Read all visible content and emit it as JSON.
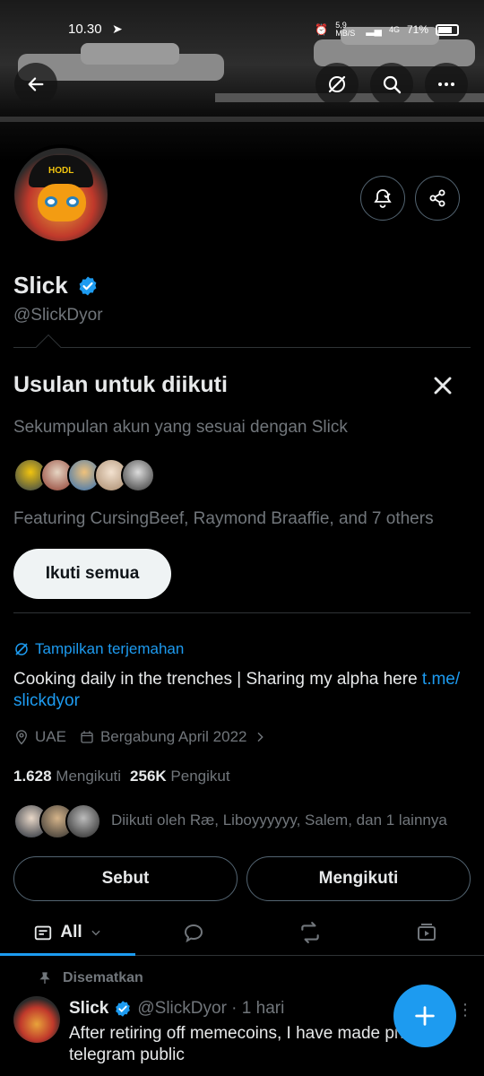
{
  "status_bar": {
    "time": "10.30",
    "network_speed": "5,9 MB/S",
    "network_type": "4G",
    "battery": "71%"
  },
  "header_icons": {
    "back": "arrow-left-icon",
    "grok": "grok-icon",
    "search": "search-icon",
    "more": "more-icon",
    "notify": "bell-check-icon",
    "share": "share-icon"
  },
  "profile": {
    "name": "Slick",
    "handle": "@SlickDyor",
    "avatar_text": "HODL"
  },
  "suggestions": {
    "title": "Usulan untuk diikuti",
    "description": "Sekumpulan akun yang sesuai dengan Slick",
    "featuring": "Featuring CursingBeef, Raymond Braaffie, and 7 others",
    "follow_all_label": "Ikuti semua"
  },
  "bio": {
    "translate_label": "Tampilkan terjemahan",
    "text": "Cooking daily in the trenches | Sharing my alpha here ",
    "link_part1": "t.me/",
    "link_part2": "slickdyor"
  },
  "meta": {
    "location": "UAE",
    "joined": "Bergabung April 2022"
  },
  "stats": {
    "following_count": "1.628",
    "following_label": "Mengikuti",
    "followers_count": "256K",
    "followers_label": "Pengikut"
  },
  "followed_by": "Diikuti oleh Ræ, Liboyyyyyy, Salem, dan 1 lainnya",
  "actions": {
    "mention_label": "Sebut",
    "following_label": "Mengikuti"
  },
  "tabs": {
    "all_label": "All"
  },
  "pinned": {
    "label": "Disematkan",
    "author": "Slick",
    "handle_time": "@SlickDyor · 1 hari",
    "text": "After retiring off memecoins, I have made private telegram public"
  },
  "colors": {
    "accent": "#1d9bf0",
    "background": "#000000",
    "text_primary": "#e7e9ea",
    "text_secondary": "#71767b"
  }
}
